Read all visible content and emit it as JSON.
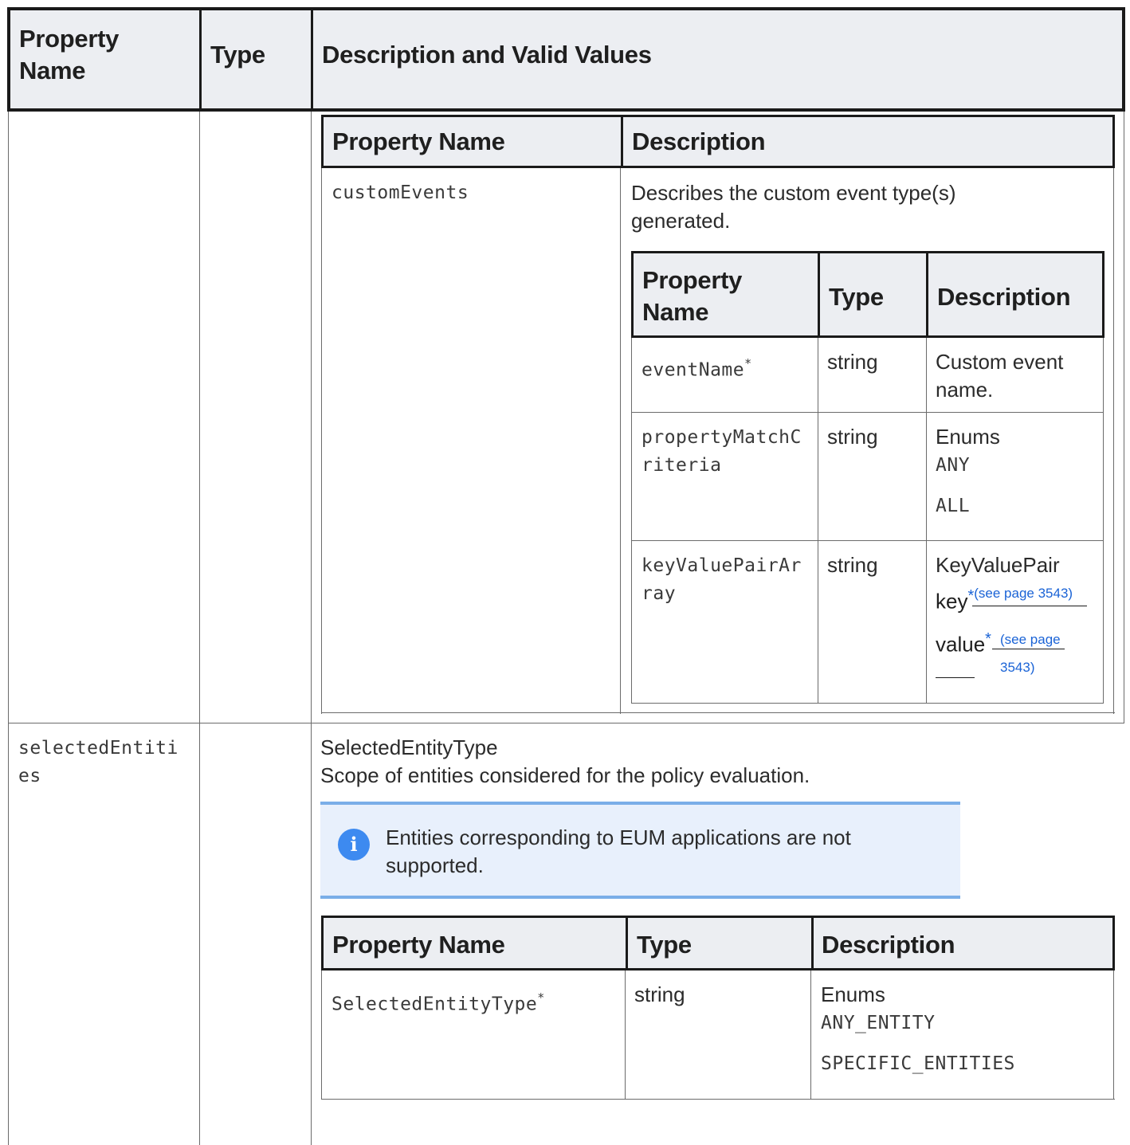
{
  "outer_table": {
    "headers": [
      "Property Name",
      "Type",
      "Description and Valid Values"
    ]
  },
  "custom_events_table": {
    "headers": [
      "Property Name",
      "Description"
    ],
    "row": {
      "name": "customEvents",
      "description": "Describes the custom event type(s) generated."
    }
  },
  "event_type_table": {
    "headers": [
      "Property Name",
      "Type",
      "Description"
    ],
    "rows": [
      {
        "name": "eventName",
        "required_mark": "*",
        "type": "string",
        "description": "Custom event name."
      },
      {
        "name": "propertyMatchCriteria",
        "type": "string",
        "description": "Enums",
        "values": [
          "ANY",
          "ALL"
        ]
      },
      {
        "name": "keyValuePairArray",
        "type": "string",
        "description": "KeyValuePair",
        "items": [
          {
            "label": "key",
            "mark": "*",
            "link": "(see page 3543)"
          },
          {
            "label": "value",
            "mark": "*",
            "link": "(see page 3543)"
          }
        ]
      }
    ]
  },
  "selected_entities": {
    "name": "selectedEntities",
    "type_name": "SelectedEntityType",
    "description": "Scope of entities considered for the policy evaluation.",
    "note": "Entities corresponding to EUM applications are not supported.",
    "note_icon": "info-icon",
    "table": {
      "headers": [
        "Property Name",
        "Type",
        "Description"
      ],
      "row": {
        "name": "SelectedEntityType",
        "required_mark": "*",
        "type": "string",
        "description": "Enums",
        "values": [
          "ANY_ENTITY",
          "SPECIFIC_ENTITIES"
        ]
      }
    }
  },
  "colors": {
    "header_bg": "#eceef2",
    "info_bg": "#e8f0fc",
    "info_border": "#7aaee8",
    "info_icon": "#3d8af0",
    "link": "#1a63d6"
  }
}
